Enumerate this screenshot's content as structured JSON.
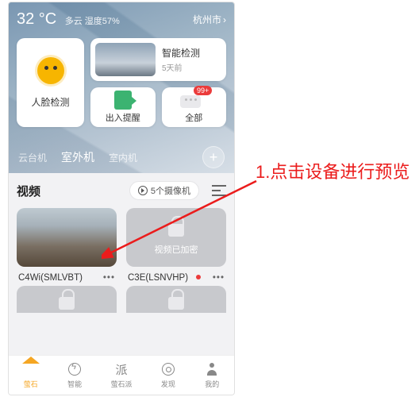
{
  "weather": {
    "temp": "32 °C",
    "cond": "多云 湿度57%",
    "city": "杭州市"
  },
  "cards": {
    "face_label": "人脸检测",
    "detect_title": "智能检测",
    "detect_time": "5天前",
    "entry_exit": "出入提醒",
    "all": "全部",
    "all_badge": "99+"
  },
  "tabs": {
    "t1": "云台机",
    "t2": "室外机",
    "t3": "室内机"
  },
  "video": {
    "section_title": "视频",
    "cam_count": "5个摄像机",
    "encrypted": "视频已加密",
    "cams": [
      {
        "name": "C4Wi(SMLVBT)"
      },
      {
        "name": "C3E(LSNVHP)"
      }
    ],
    "more": "•••"
  },
  "tabbar": {
    "t0": "萤石",
    "t1": "智能",
    "t2": "萤石派",
    "t3": "发现",
    "t4": "我的",
    "t2_glyph": "派"
  },
  "annotation": {
    "line": "1.点击设备进行预览"
  }
}
